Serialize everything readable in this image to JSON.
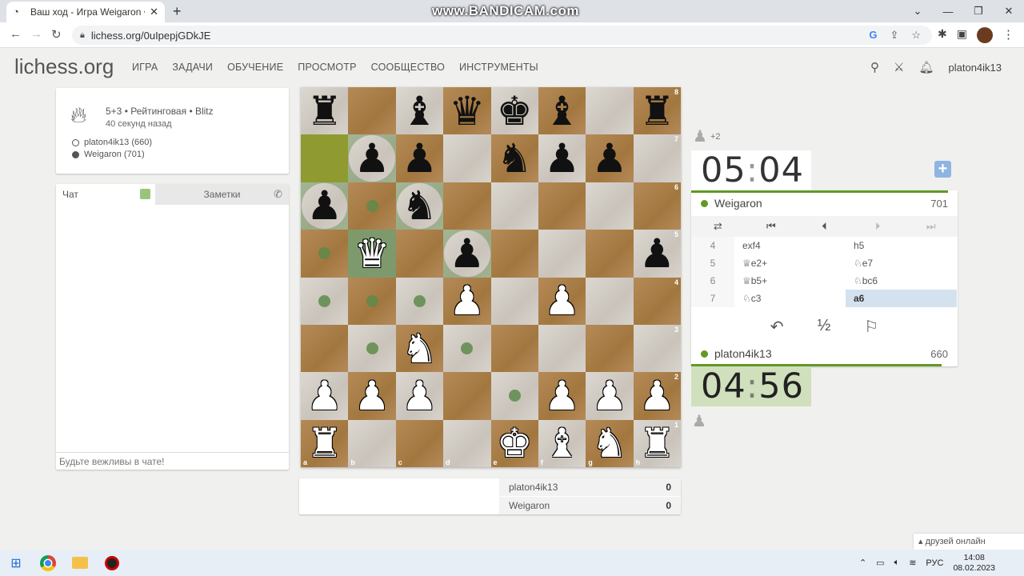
{
  "browser": {
    "tab_title": "Ваш ход - Игра Weigaron • liche",
    "url": "lichess.org/0uIpepjGDkJE",
    "watermark": "www.BANDICAM.com"
  },
  "site": {
    "logo": "lichess.org",
    "nav": [
      "ИГРА",
      "ЗАДАЧИ",
      "ОБУЧЕНИЕ",
      "ПРОСМОТР",
      "СООБЩЕСТВО",
      "ИНСТРУМЕНТЫ"
    ],
    "username": "platon4ik13"
  },
  "game_info": {
    "setup": "5+3 • Рейтинговая • Blitz",
    "ago": "40 секунд назад",
    "white": "platon4ik13 (660)",
    "black": "Weigaron (701)"
  },
  "chat": {
    "tab_chat": "Чат",
    "tab_notes": "Заметки",
    "placeholder": "Будьте вежливы в чате!"
  },
  "board": {
    "ranks": [
      [
        "r",
        "",
        "b",
        "q",
        "k",
        "b",
        "",
        "r"
      ],
      [
        "",
        "p",
        "p",
        "",
        "n",
        "p",
        "p",
        ""
      ],
      [
        "p",
        "",
        "n",
        "",
        "",
        "",
        "",
        ""
      ],
      [
        "",
        "Q",
        "",
        "p",
        "",
        "",
        "",
        "p"
      ],
      [
        "",
        "",
        "",
        "P",
        "",
        "P",
        "",
        ""
      ],
      [
        "",
        "",
        "N",
        "",
        "",
        "",
        "",
        ""
      ],
      [
        "P",
        "P",
        "P",
        "",
        "",
        "P",
        "P",
        "P"
      ],
      [
        "R",
        "",
        "",
        "",
        "K",
        "B",
        "N",
        "R"
      ]
    ],
    "last_move_squares": [
      "a7"
    ],
    "selected_square": "b5",
    "move_dots": [
      "b6",
      "a5",
      "a4",
      "b4",
      "c4",
      "b3",
      "d3",
      "e2"
    ],
    "capture_rings": [
      "a6",
      "b7",
      "c6",
      "d5"
    ],
    "files": [
      "a",
      "b",
      "c",
      "d",
      "e",
      "f",
      "g",
      "h"
    ],
    "ranks_labels": [
      "8",
      "7",
      "6",
      "5",
      "4",
      "3",
      "2",
      "1"
    ]
  },
  "material": {
    "white_name": "platon4ik13",
    "white_score": "0",
    "black_name": "Weigaron",
    "black_score": "0"
  },
  "opponent": {
    "diff": "+2",
    "clock_min": "05",
    "clock_sec": "04",
    "name": "Weigaron",
    "rating": "701"
  },
  "me": {
    "clock_min": "04",
    "clock_sec": "56",
    "name": "platon4ik13",
    "rating": "660"
  },
  "moves": [
    {
      "n": "4",
      "w": "exf4",
      "b": "h5"
    },
    {
      "n": "5",
      "w": "♕e2+",
      "b": "♘e7"
    },
    {
      "n": "6",
      "w": "♕b5+",
      "b": "♘bc6"
    },
    {
      "n": "7",
      "w": "♘c3",
      "b": "a6"
    }
  ],
  "friends": "друзей онлайн",
  "tray": {
    "lang": "РУС",
    "time": "14:08",
    "date": "08.02.2023"
  }
}
